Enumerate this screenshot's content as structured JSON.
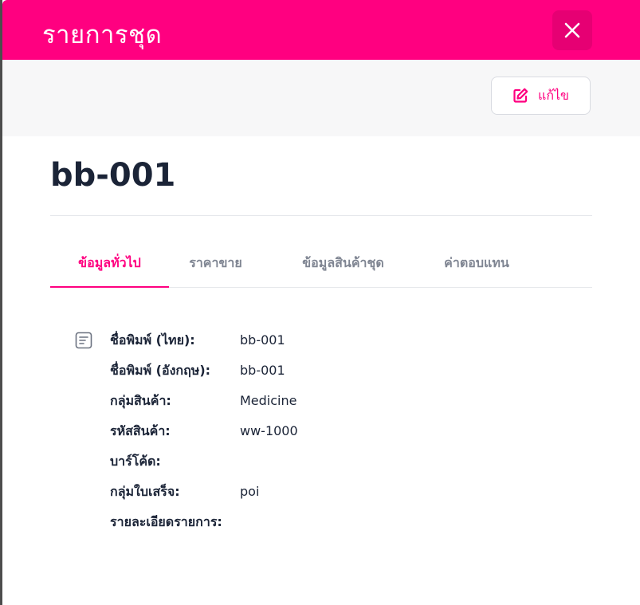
{
  "header": {
    "title": "รายการชุด",
    "background_color": "#ff0080",
    "close_icon": "close-icon"
  },
  "toolbar": {
    "edit_label": "แก้ไข",
    "edit_icon": "edit-icon"
  },
  "record": {
    "title": "bb-001"
  },
  "tabs": [
    {
      "label": "ข้อมูลทั่วไป",
      "active": true
    },
    {
      "label": "ราคาขาย",
      "active": false
    },
    {
      "label": "ข้อมูลสินค้าชุด",
      "active": false
    },
    {
      "label": "ค่าตอบแทน",
      "active": false
    }
  ],
  "general_info": {
    "icon": "document-icon",
    "fields": [
      {
        "label": "ชื่อพิมพ์ (ไทย):",
        "value": "bb-001"
      },
      {
        "label": "ชื่อพิมพ์ (อังกฤษ):",
        "value": "bb-001"
      },
      {
        "label": "กลุ่มสินค้า:",
        "value": "Medicine"
      },
      {
        "label": "รหัสสินค้า:",
        "value": "ww-1000"
      },
      {
        "label": "บาร์โค้ด:",
        "value": ""
      },
      {
        "label": "กลุ่มใบเสร็จ:",
        "value": "poi"
      },
      {
        "label": "รายละเอียดรายการ:",
        "value": ""
      }
    ]
  },
  "colors": {
    "accent": "#ff0080",
    "text_dark": "#1b2437",
    "text_muted": "#7f8592"
  }
}
